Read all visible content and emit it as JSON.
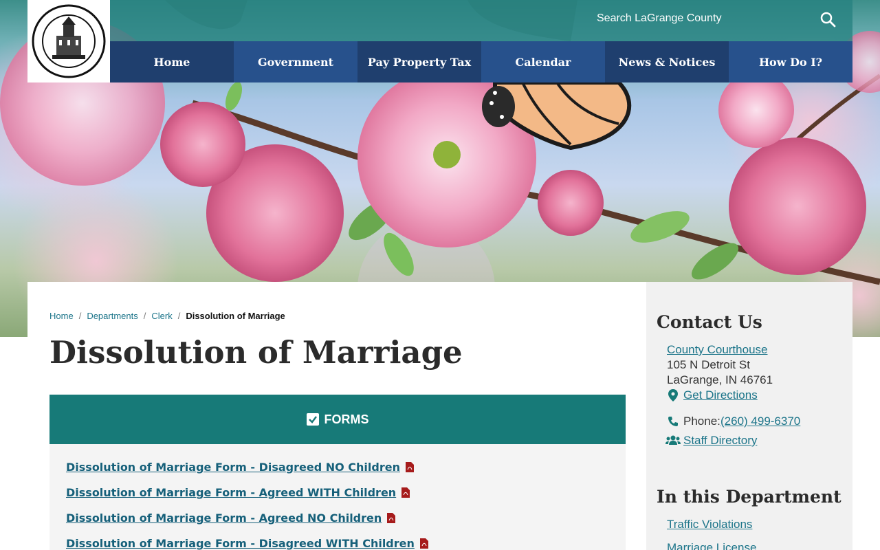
{
  "header": {
    "search_placeholder": "Search LaGrange County",
    "logo_alt": "LaGrange County Indiana seal"
  },
  "nav": {
    "items": [
      {
        "label": "Home"
      },
      {
        "label": "Government"
      },
      {
        "label": "Pay Property Tax"
      },
      {
        "label": "Calendar"
      },
      {
        "label": "News & Notices"
      },
      {
        "label": "How Do I?"
      }
    ]
  },
  "breadcrumb": {
    "items": [
      "Home",
      "Departments",
      "Clerk"
    ],
    "current": "Dissolution of Marriage"
  },
  "page": {
    "title": "Dissolution of Marriage"
  },
  "forms": {
    "header": "FORMS",
    "links": [
      "Dissolution of Marriage Form - Disagreed NO Children",
      "Dissolution of Marriage Form - Agreed WITH Children",
      "Dissolution of Marriage Form - Agreed NO Children",
      "Dissolution of Marriage Form - Disagreed WITH Children"
    ]
  },
  "contact": {
    "heading": "Contact Us",
    "location_name": "County Courthouse",
    "address_line1": "105 N Detroit St",
    "address_line2": "LaGrange, IN 46761",
    "directions": "Get Directions",
    "phone_label": "Phone:",
    "phone": "(260) 499-6370",
    "staff_directory": "Staff Directory"
  },
  "department": {
    "heading": "In this Department",
    "links": [
      "Traffic Violations",
      "Marriage License"
    ]
  },
  "colors": {
    "nav_dark": "#1f3f6e",
    "nav_mid": "#27518c",
    "teal": "#177a78",
    "link": "#16607a"
  }
}
